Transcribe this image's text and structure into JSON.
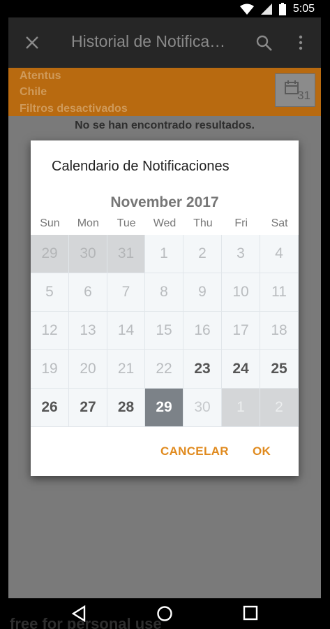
{
  "status_bar": {
    "time": "5:05"
  },
  "toolbar": {
    "title": "Historial de Notifica…"
  },
  "banner": {
    "line1": "Atentus",
    "line2": "Chile",
    "line3": "Filtros desactivados",
    "calendar_day": "31"
  },
  "empty_message": "No se han encontrado resultados.",
  "dialog": {
    "title": "Calendario de Notificaciones",
    "month_label": "November 2017",
    "weekdays": [
      "Sun",
      "Mon",
      "Tue",
      "Wed",
      "Thu",
      "Fri",
      "Sat"
    ],
    "days": [
      [
        "29",
        "30",
        "31",
        "1",
        "2",
        "3",
        "4"
      ],
      [
        "5",
        "6",
        "7",
        "8",
        "9",
        "10",
        "11"
      ],
      [
        "12",
        "13",
        "14",
        "15",
        "16",
        "17",
        "18"
      ],
      [
        "19",
        "20",
        "21",
        "22",
        "23",
        "24",
        "25"
      ],
      [
        "26",
        "27",
        "28",
        "29",
        "30",
        "1",
        "2"
      ]
    ],
    "cancel_label": "CANCELAR",
    "ok_label": "OK",
    "selected_day": "29"
  },
  "watermark": "free for personal use",
  "colors": {
    "accent": "#e08a1e",
    "banner": "#b86a10",
    "toolbar": "#262626"
  }
}
